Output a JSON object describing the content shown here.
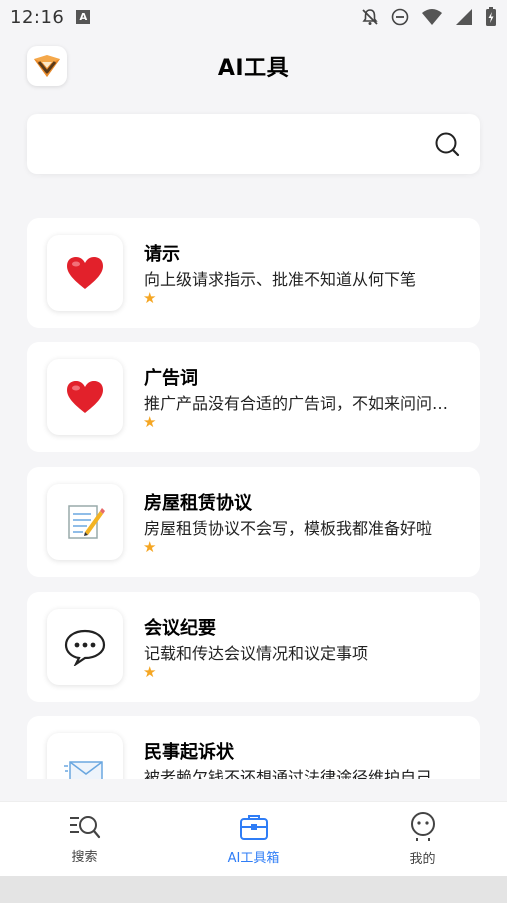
{
  "status_bar": {
    "time": "12:16",
    "badge": "A",
    "icons": [
      "notifications-off-icon",
      "do-not-disturb-icon",
      "wifi-icon",
      "signal-icon",
      "battery-charging-icon"
    ]
  },
  "header": {
    "title": "AI工具",
    "logo_icon": "fox-logo-icon"
  },
  "search": {
    "value": "",
    "placeholder": "",
    "icon": "search-icon"
  },
  "tools": [
    {
      "title": "请示",
      "desc": "向上级请求指示、批准不知道从何下笔",
      "icon": "❤️",
      "icon_name": "heart-icon",
      "rating": 1
    },
    {
      "title": "广告词",
      "desc": "推广产品没有合适的广告词，不如来问问我吧",
      "icon": "❤️",
      "icon_name": "heart-icon",
      "rating": 1
    },
    {
      "title": "房屋租赁协议",
      "desc": "房屋租赁协议不会写，模板我都准备好啦",
      "icon": "📝",
      "icon_name": "memo-icon",
      "rating": 1
    },
    {
      "title": "会议纪要",
      "desc": "记载和传达会议情况和议定事项",
      "icon": "💬",
      "icon_name": "speech-bubble-icon",
      "rating": 1
    },
    {
      "title": "民事起诉状",
      "desc": "被老赖欠钱不还想通过法律途径维护自己的权益",
      "icon": "📨",
      "icon_name": "envelope-icon",
      "rating": 1
    }
  ],
  "bottom_nav": {
    "items": [
      {
        "label": "搜索",
        "icon": "search-list-icon",
        "active": false
      },
      {
        "label": "AI工具箱",
        "icon": "toolbox-icon",
        "active": true
      },
      {
        "label": "我的",
        "icon": "profile-icon",
        "active": false
      }
    ]
  },
  "colors": {
    "accent": "#2f7df6",
    "star": "#f5a623",
    "background": "#f5f5f7"
  }
}
